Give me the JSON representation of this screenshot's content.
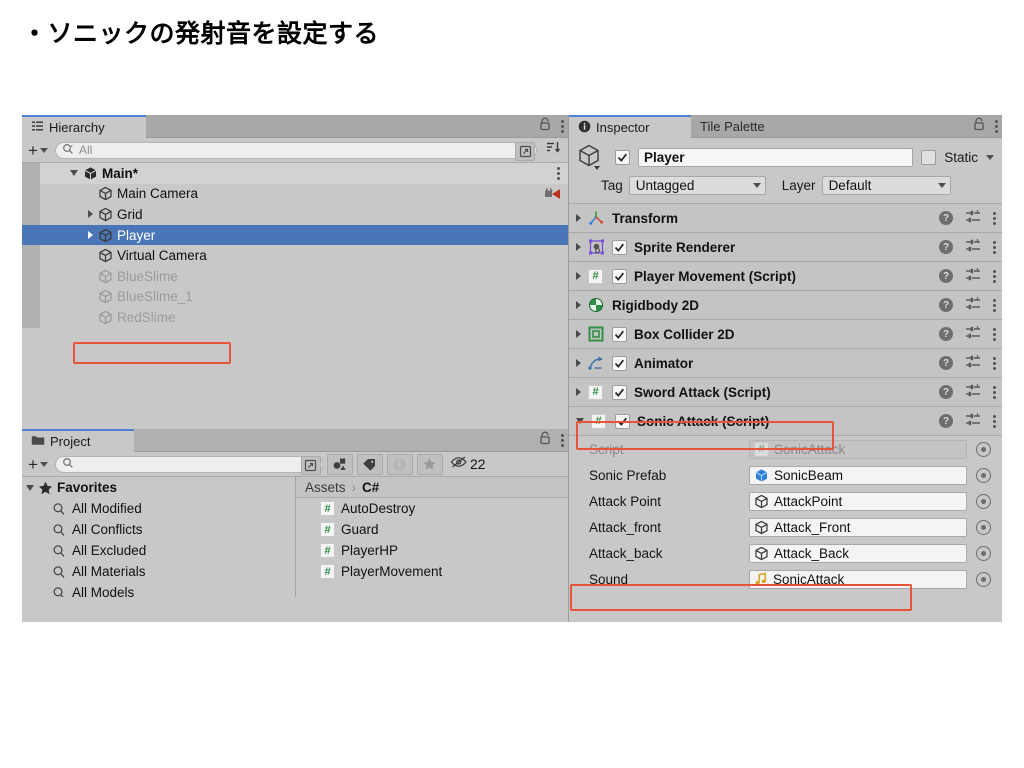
{
  "slide": {
    "title": "・ソニックの発射音を設定する"
  },
  "hierarchy": {
    "tab_label": "Hierarchy",
    "tab_icon": "hierarchy-icon",
    "lock_icon": "lock-icon",
    "menu_icon": "kebab-menu-icon",
    "add_label": "+",
    "search_placeholder": "All",
    "search_icon": "search-icon",
    "popup_icon": "popup-window-icon",
    "sort_icon": "sort-icon",
    "items": [
      {
        "label": "Main*",
        "depth": 0,
        "expanded": true,
        "has_arrow": true,
        "bold": true,
        "selected": false,
        "dim": false,
        "icon": "unity-scene-icon",
        "row_icon": "kebab-menu-icon"
      },
      {
        "label": "Main Camera",
        "depth": 1,
        "expanded": false,
        "has_arrow": false,
        "bold": false,
        "selected": false,
        "dim": false,
        "icon": "gameobject-cube-icon",
        "row_icon": "cinemachine-icon"
      },
      {
        "label": "Grid",
        "depth": 1,
        "expanded": false,
        "has_arrow": true,
        "bold": false,
        "selected": false,
        "dim": false,
        "icon": "gameobject-cube-icon",
        "row_icon": ""
      },
      {
        "label": "Player",
        "depth": 1,
        "expanded": false,
        "has_arrow": true,
        "bold": false,
        "selected": true,
        "dim": false,
        "icon": "gameobject-cube-icon",
        "row_icon": ""
      },
      {
        "label": "Virtual Camera",
        "depth": 1,
        "expanded": false,
        "has_arrow": false,
        "bold": false,
        "selected": false,
        "dim": false,
        "icon": "gameobject-cube-icon",
        "row_icon": ""
      },
      {
        "label": "BlueSlime",
        "depth": 1,
        "expanded": false,
        "has_arrow": false,
        "bold": false,
        "selected": false,
        "dim": true,
        "icon": "gameobject-cube-icon",
        "row_icon": ""
      },
      {
        "label": "BlueSlime_1",
        "depth": 1,
        "expanded": false,
        "has_arrow": false,
        "bold": false,
        "selected": false,
        "dim": true,
        "icon": "gameobject-cube-icon",
        "row_icon": ""
      },
      {
        "label": "RedSlime",
        "depth": 1,
        "expanded": false,
        "has_arrow": false,
        "bold": false,
        "selected": false,
        "dim": true,
        "icon": "gameobject-cube-icon",
        "row_icon": ""
      }
    ]
  },
  "project": {
    "tab_label": "Project",
    "tab_icon": "folder-icon",
    "lock_icon": "lock-icon",
    "menu_icon": "kebab-menu-icon",
    "add_label": "+",
    "search_placeholder": "",
    "search_icon": "search-icon",
    "popup_icon": "popup-window-icon",
    "toolbar_icons": [
      "asset-type-filter-icon",
      "label-tag-icon",
      "warning-filter-icon",
      "favorite-star-icon"
    ],
    "hidden_count_icon": "hidden-eye-icon",
    "hidden_count": "22",
    "favorites": {
      "header": "Favorites",
      "header_icon": "star-icon",
      "items": [
        {
          "label": "All Modified",
          "icon": "saved-search-icon"
        },
        {
          "label": "All Conflicts",
          "icon": "saved-search-icon"
        },
        {
          "label": "All Excluded",
          "icon": "saved-search-icon"
        },
        {
          "label": "All Materials",
          "icon": "saved-search-icon"
        },
        {
          "label": "All Models",
          "icon": "saved-search-icon"
        }
      ]
    },
    "breadcrumb": {
      "root": "Assets",
      "separator": "›",
      "current": "C#"
    },
    "assets": [
      {
        "label": "AutoDestroy",
        "icon": "csharp-script-icon"
      },
      {
        "label": "Guard",
        "icon": "csharp-script-icon"
      },
      {
        "label": "PlayerHP",
        "icon": "csharp-script-icon"
      },
      {
        "label": "PlayerMovement",
        "icon": "csharp-script-icon"
      }
    ]
  },
  "inspector": {
    "tabs": [
      {
        "label": "Inspector",
        "active": true,
        "icon": "info-icon"
      },
      {
        "label": "Tile Palette",
        "active": false,
        "icon": ""
      }
    ],
    "lock_icon": "lock-icon",
    "menu_icon": "kebab-menu-icon",
    "object_icon": "gameobject-cube-icon",
    "object_enabled": true,
    "object_name": "Player",
    "static_label": "Static",
    "static_checked": false,
    "tag_label": "Tag",
    "tag_value": "Untagged",
    "layer_label": "Layer",
    "layer_value": "Default",
    "components": [
      {
        "label": "Transform",
        "icon": "transform-icon",
        "expanded": false,
        "has_checkbox": false,
        "checked": false,
        "highlighted": false
      },
      {
        "label": "Sprite Renderer",
        "icon": "sprite-renderer-icon",
        "expanded": false,
        "has_checkbox": true,
        "checked": true,
        "highlighted": false
      },
      {
        "label": "Player Movement (Script)",
        "icon": "csharp-script-icon",
        "expanded": false,
        "has_checkbox": true,
        "checked": true,
        "highlighted": false
      },
      {
        "label": "Rigidbody 2D",
        "icon": "rigidbody2d-icon",
        "expanded": false,
        "has_checkbox": false,
        "checked": false,
        "highlighted": false
      },
      {
        "label": "Box Collider 2D",
        "icon": "boxcollider2d-icon",
        "expanded": false,
        "has_checkbox": true,
        "checked": true,
        "highlighted": false
      },
      {
        "label": "Animator",
        "icon": "animator-icon",
        "expanded": false,
        "has_checkbox": true,
        "checked": true,
        "highlighted": false
      },
      {
        "label": "Sword Attack (Script)",
        "icon": "csharp-script-icon",
        "expanded": false,
        "has_checkbox": true,
        "checked": true,
        "highlighted": false
      },
      {
        "label": "Sonic Attack (Script)",
        "icon": "csharp-script-icon",
        "expanded": true,
        "has_checkbox": true,
        "checked": true,
        "highlighted": true
      }
    ],
    "component_row_icons": {
      "help": "help-icon",
      "preset": "preset-settings-icon",
      "menu": "kebab-menu-icon"
    },
    "properties": [
      {
        "label": "Script",
        "value": "SonicAttack",
        "value_icon": "csharp-script-icon",
        "readonly": true,
        "highlighted": false
      },
      {
        "label": "Sonic Prefab",
        "value": "SonicBeam",
        "value_icon": "prefab-icon",
        "readonly": false,
        "highlighted": false
      },
      {
        "label": "Attack Point",
        "value": "AttackPoint",
        "value_icon": "gameobject-cube-icon",
        "readonly": false,
        "highlighted": false
      },
      {
        "label": "Attack_front",
        "value": "Attack_Front",
        "value_icon": "gameobject-cube-icon",
        "readonly": false,
        "highlighted": false
      },
      {
        "label": "Attack_back",
        "value": "Attack_Back",
        "value_icon": "gameobject-cube-icon",
        "readonly": false,
        "highlighted": false
      },
      {
        "label": "Sound",
        "value": "SonicAttack",
        "value_icon": "audioclip-icon",
        "readonly": false,
        "highlighted": true
      }
    ],
    "picker_icon": "object-picker-icon"
  },
  "colors": {
    "panel_bg": "#c8c8c8",
    "tabbar_bg": "#a8a8a8",
    "selection_blue": "#4a76b8",
    "annotation_red": "#e8533a",
    "csharp_green": "#2f8f46",
    "prefab_blue": "#2d80d8",
    "audio_orange": "#e0a020"
  }
}
